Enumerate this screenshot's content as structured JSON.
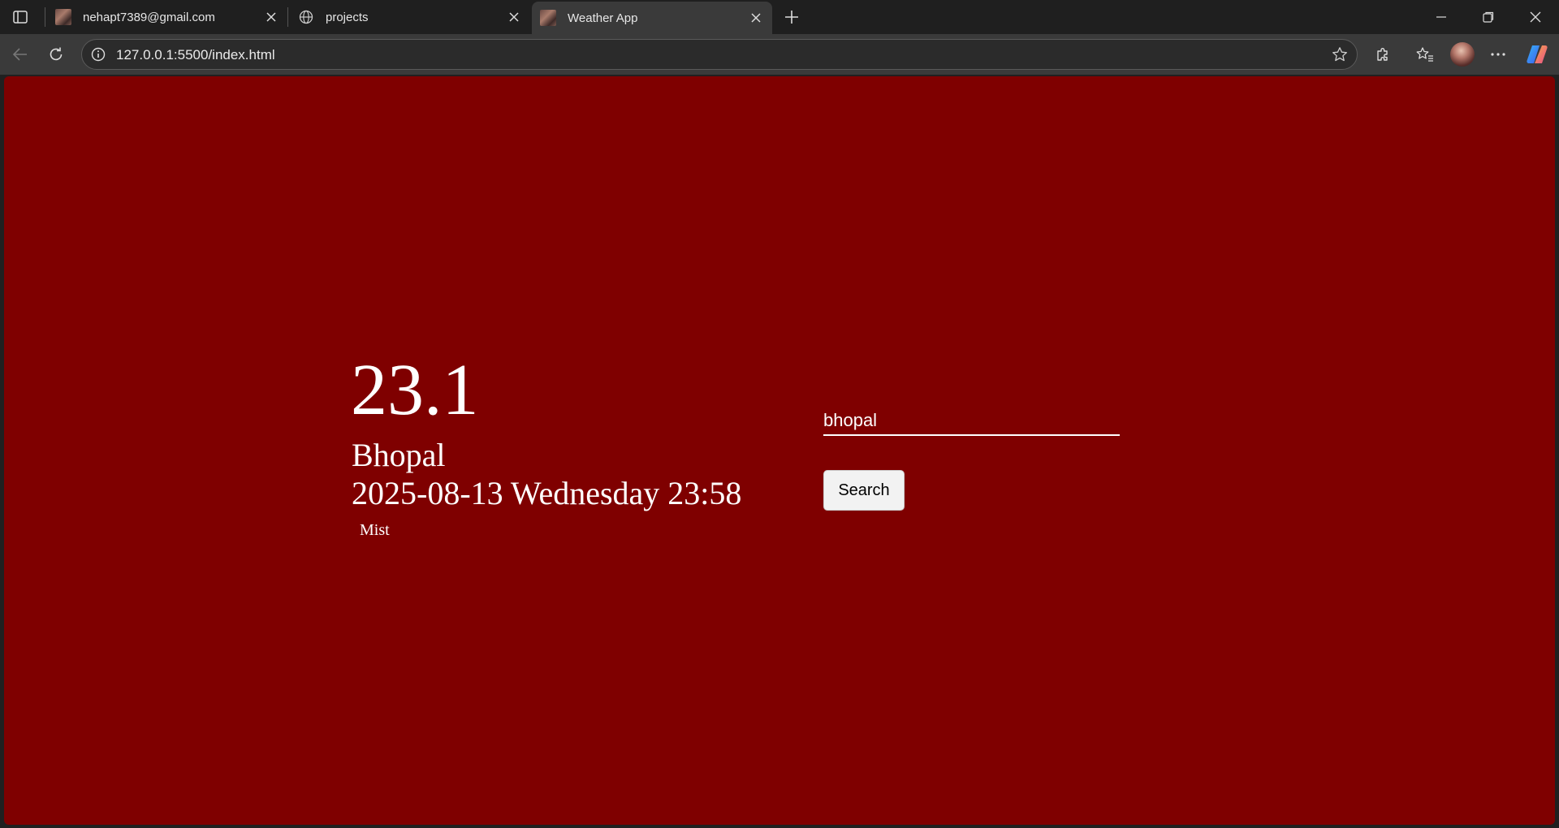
{
  "browser": {
    "tabs": [
      {
        "title": "nehapt7389@gmail.com",
        "active": false
      },
      {
        "title": "projects",
        "active": false
      },
      {
        "title": "Weather App",
        "active": true
      }
    ],
    "address": {
      "url": "127.0.0.1:5500/index.html"
    }
  },
  "weather": {
    "temperature": "23.1",
    "city": "Bhopal",
    "datetime": "2025-08-13 Wednesday 23:58",
    "condition": "Mist"
  },
  "search": {
    "input_value": "bhopal",
    "button_label": "Search"
  },
  "colors": {
    "page_background": "#7f0000",
    "text": "#ffffff"
  }
}
